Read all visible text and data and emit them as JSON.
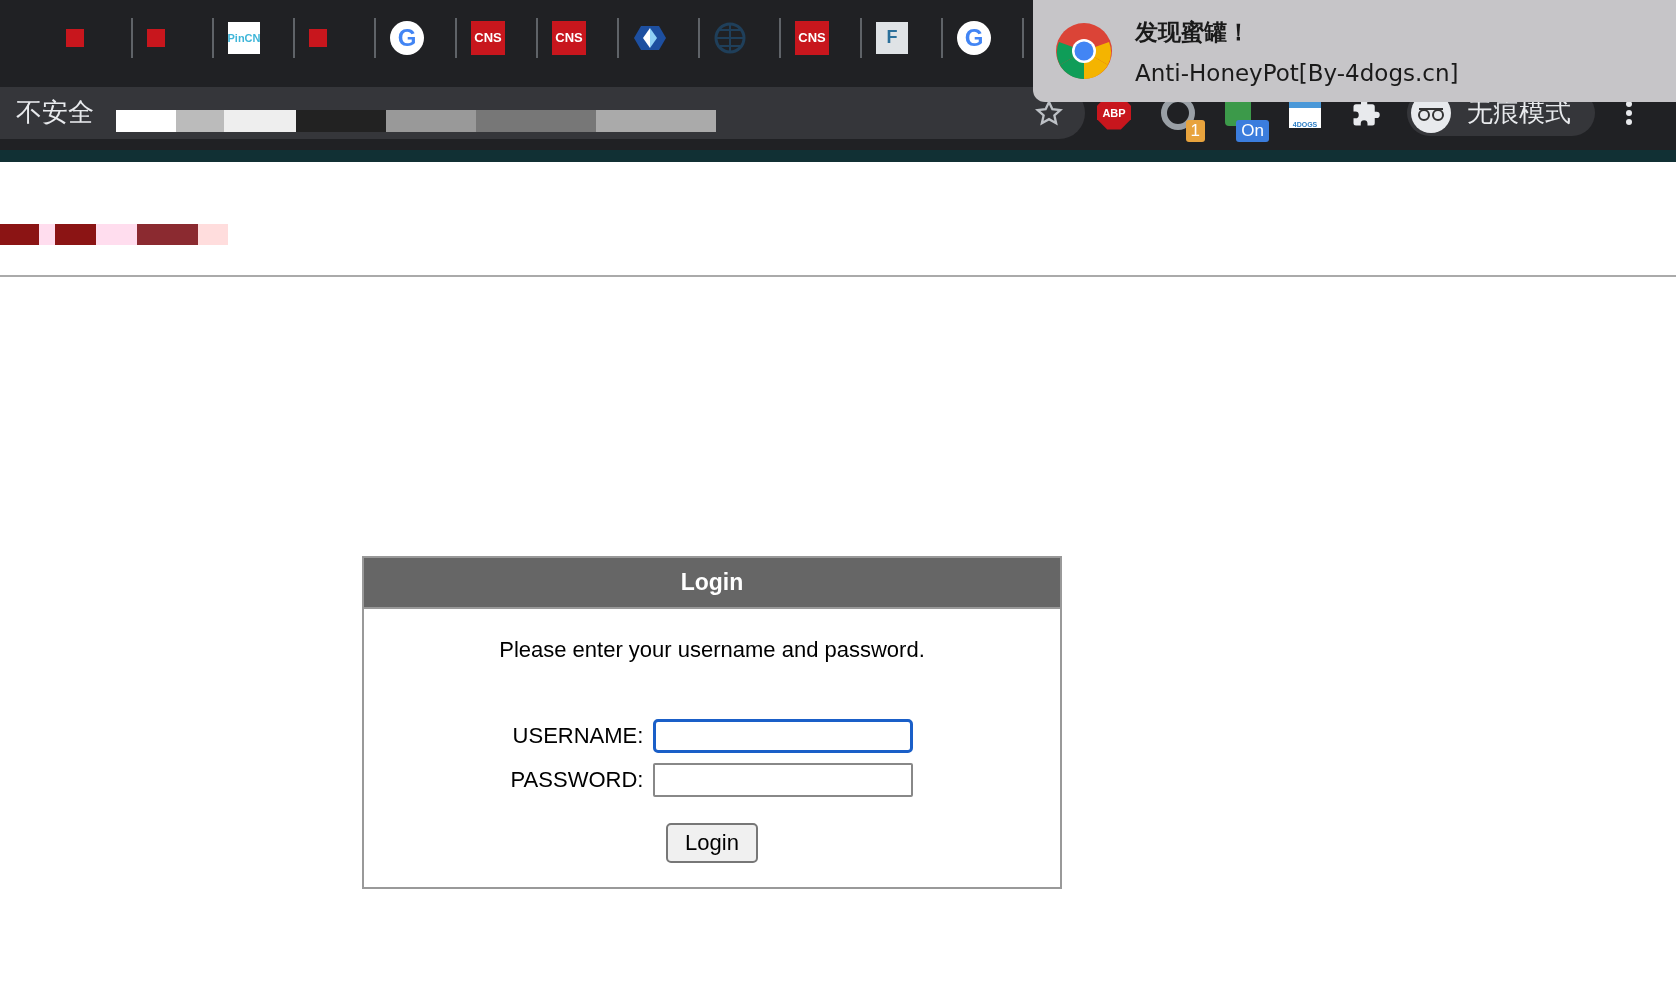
{
  "bookmarks": [
    {
      "kind": "cns-small"
    },
    {
      "kind": "cns-small"
    },
    {
      "kind": "pincn",
      "icon_text": "PinCN"
    },
    {
      "kind": "cns-small"
    },
    {
      "kind": "google",
      "icon_text": "G"
    },
    {
      "kind": "cns",
      "icon_text": "CNS"
    },
    {
      "kind": "cns",
      "icon_text": "CNS"
    },
    {
      "kind": "shield"
    },
    {
      "kind": "globe"
    },
    {
      "kind": "cns",
      "icon_text": "CNS"
    },
    {
      "kind": "magnifier",
      "icon_text": "F"
    },
    {
      "kind": "google",
      "icon_text": "G"
    }
  ],
  "address_bar": {
    "security_label": "不安全"
  },
  "extensions": [
    {
      "kind": "abp",
      "text": "ABP"
    },
    {
      "kind": "ring",
      "badge": "1"
    },
    {
      "kind": "green",
      "badge": "On"
    },
    {
      "kind": "dogs",
      "text": "4DOGS"
    },
    {
      "kind": "puzzle"
    }
  ],
  "incognito_label": "无痕模式",
  "notification": {
    "title": "发现蜜罐！",
    "message": "Anti-HoneyPot[By-4dogs.cn]"
  },
  "login": {
    "title": "Login",
    "prompt": "Please enter your username and password.",
    "fields": [
      {
        "label": "USERNAME:",
        "focused": true
      },
      {
        "label": "PASSWORD:",
        "focused": false
      }
    ],
    "button": "Login"
  }
}
